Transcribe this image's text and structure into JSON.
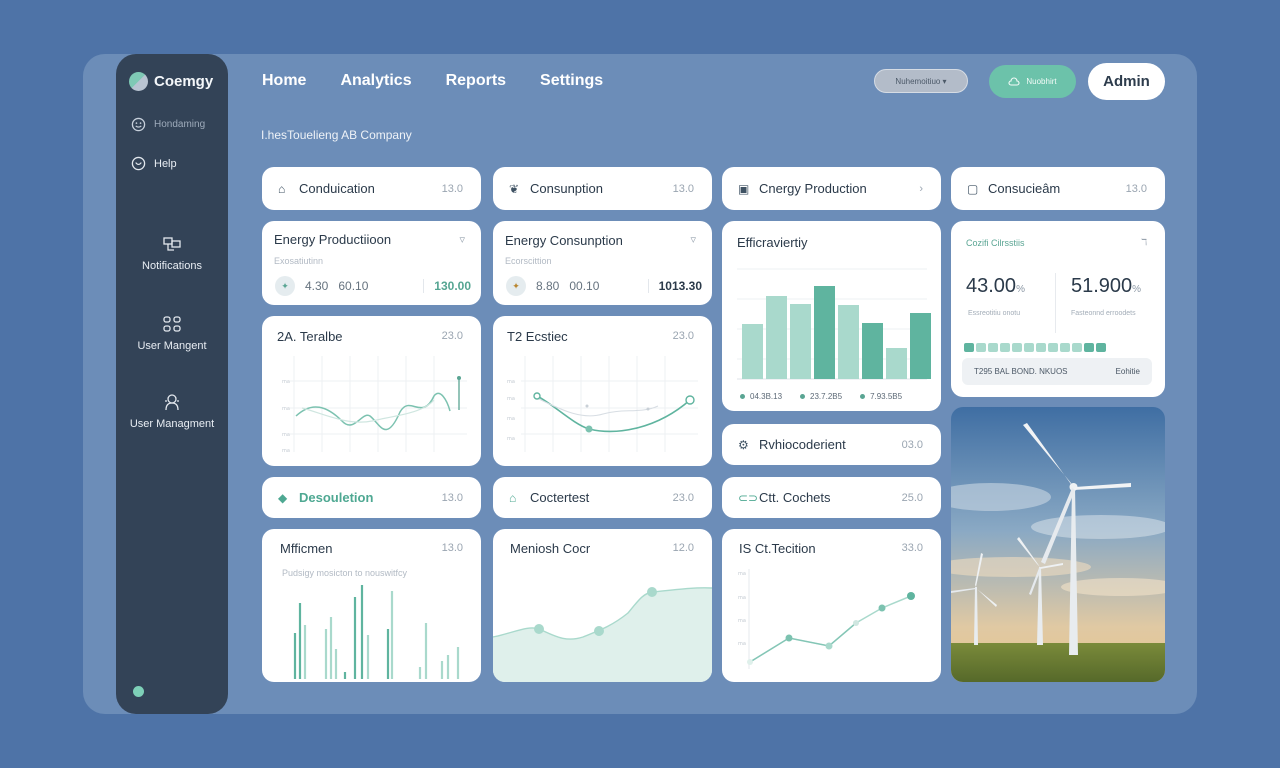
{
  "brand": {
    "name": "Coemgy"
  },
  "sidebar": {
    "items": [
      {
        "label": "Hondaming"
      },
      {
        "label": "Help"
      },
      {
        "label": "Notifications"
      },
      {
        "label": "User Mangent"
      },
      {
        "label": "User Managment"
      }
    ]
  },
  "nav": [
    "Home",
    "Analytics",
    "Reports",
    "Settings"
  ],
  "header": {
    "dropdown": "Nuhemoitiuo ▾",
    "green_pill": "Nuobhirt",
    "admin": "Admin"
  },
  "company": "I.hesTouelieng AB Company",
  "row1": [
    {
      "label": "Conduication",
      "value": "13.0"
    },
    {
      "label": "Consunption",
      "value": "13.0"
    },
    {
      "label": "Cnergy Production",
      "value": "›"
    },
    {
      "label": "Consucieâm",
      "value": "13.0"
    }
  ],
  "energy_production": {
    "title": "Energy Productiioon",
    "sub": "Exosatiutinn",
    "a": "4.30",
    "b": "60.10",
    "strong": "130.00"
  },
  "energy_consumption": {
    "title": "Energy Consunption",
    "sub": "Ecorscittion",
    "a": "8.80",
    "b": "00.10",
    "strong": "1013.30"
  },
  "efficiency_chart": {
    "title": "Efficraviertiy",
    "legend": [
      "04.3B.13",
      "23.7.2B5",
      "7.93.5B5"
    ]
  },
  "stats_card": {
    "title": "Cozifi Cilrsstiis",
    "corner": "ℸ",
    "n1": "43.00",
    "n1_unit": "%",
    "n1_cap": "Essreotitiu onotu",
    "n2": "51.900",
    "n2_unit": "%",
    "n2_cap": "Fasteonnd erroodets",
    "footer_left": "T295 BAL BOND. NKUOS",
    "footer_right": "Eohitie"
  },
  "terralbe": {
    "title": "2A. Teralbe",
    "value": "23.0"
  },
  "ecstiec": {
    "title": "T2 Ecstiec",
    "value": "23.0"
  },
  "row_mid": {
    "label": "Rvhiocoderient",
    "value": "03.0"
  },
  "row3": [
    {
      "label": "Desouletion",
      "value": "13.0"
    },
    {
      "label": "Coctertest",
      "value": "23.0"
    },
    {
      "label": "Ctt. Cochets",
      "value": "25.0"
    }
  ],
  "mfficmen": {
    "title": "Mfficmen",
    "value": "13.0",
    "sub": "Pudsigy mosicton to nouswitfcy"
  },
  "meniosh": {
    "title": "Meniosh Cocr",
    "value": "12.0"
  },
  "ctection": {
    "title": "IS Ct.Tecition",
    "value": "33.0"
  },
  "colors": {
    "accent": "#5fb49f",
    "sidebar": "#334357",
    "frame": "#6c8db8",
    "bg": "#4e73a7"
  }
}
